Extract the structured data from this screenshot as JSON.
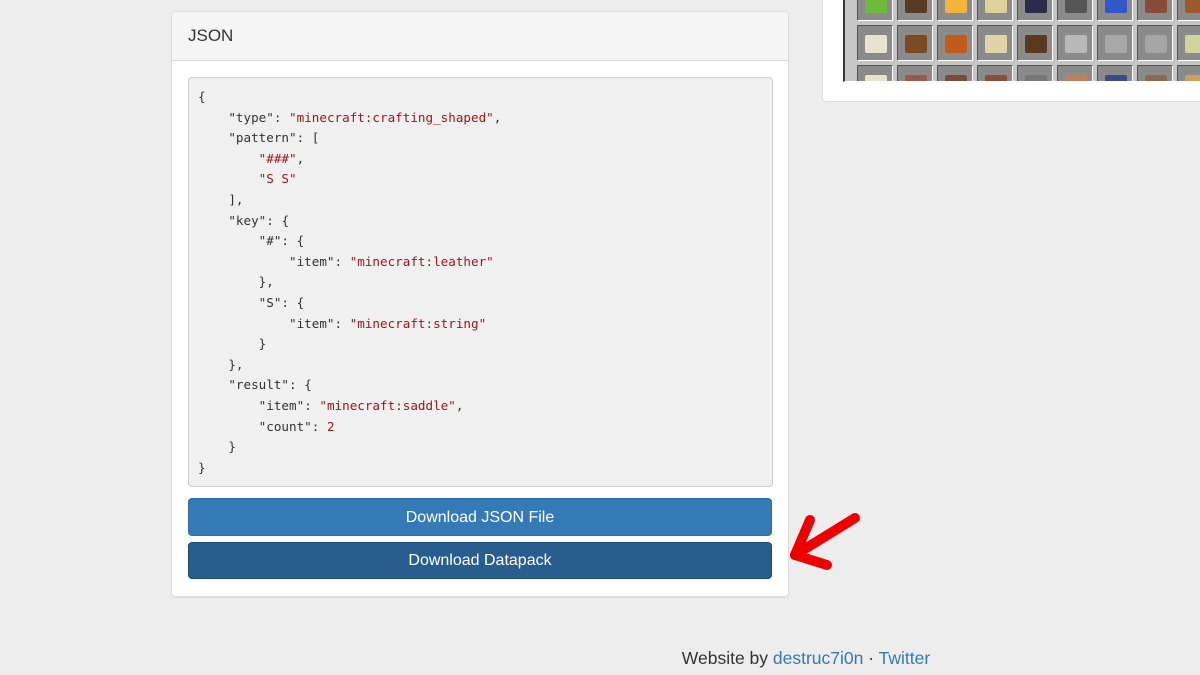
{
  "panel": {
    "title": "JSON",
    "code": "{\n    \"type\": \"minecraft:crafting_shaped\",\n    \"pattern\": [\n        \"###\",\n        \"S S\"\n    ],\n    \"key\": {\n        \"#\": {\n            \"item\": \"minecraft:leather\"\n        },\n        \"S\": {\n            \"item\": \"minecraft:string\"\n        }\n    },\n    \"result\": {\n        \"item\": \"minecraft:saddle\",\n        \"count\": 2\n    }\n}",
    "download_json_label": "Download JSON File",
    "download_datapack_label": "Download Datapack"
  },
  "inventory": {
    "rows": [
      [
        "#6dbb3a",
        "#5a3b22",
        "#f2b43a",
        "#e0d29a",
        "#2c2b4a",
        "#555555",
        "#3157c9",
        "#8a4a3a",
        "#9a5a2a"
      ],
      [
        "#e8e2cf",
        "#7a4a22",
        "#c25a1a",
        "#e0d3a6",
        "#5a3a1e",
        "#b8b8b8",
        "#a8a8a8",
        "#a5a5a5",
        "#cfd59a"
      ],
      [
        "#e8e2cf",
        "#9a5a4a",
        "#7a4a3a",
        "#8a4e3e",
        "#777777",
        "#c08060",
        "#3a4a8a",
        "#8b6a50",
        "#c8a060"
      ]
    ]
  },
  "colors": {
    "primary": "#337ab7",
    "primary_dark": "#285e8e",
    "annotation_arrow": "#ee0000",
    "json_string": "#a31515"
  },
  "footer": {
    "prefix": "Website by ",
    "author_link": "destruc7i0n",
    "separator": " · ",
    "twitter_link": "Twitter"
  }
}
